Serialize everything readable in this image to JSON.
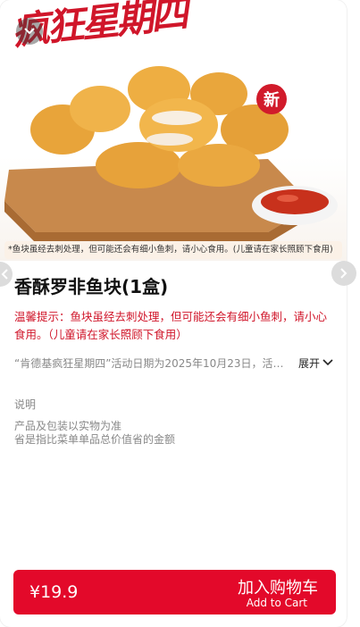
{
  "hero": {
    "promo_title": "疯狂星期四",
    "new_badge": "新",
    "caption": "*鱼块虽经去刺处理，但可能还会有细小鱼刺，请小心食用。(儿童请在家长照顾下食用)"
  },
  "product": {
    "name": "香酥罗非鱼块(1盒)",
    "notice": "温馨提示：鱼块虽经去刺处理，但可能还会有细小鱼刺，请小心食用。（儿童请在家长照顾下食用）",
    "activity": "“肯德基疯狂星期四”活动日期为2025年10月23日，活…",
    "expand_label": "展开"
  },
  "description": {
    "heading": "说明",
    "lines": [
      "产品及包装以实物为准",
      "省是指比菜单单品总价值省的金额"
    ]
  },
  "cart": {
    "price": "¥19.9",
    "add_cn": "加入购物车",
    "add_en": "Add to Cart"
  },
  "colors": {
    "brand_red": "#e3092a",
    "notice_red": "#d0162a"
  },
  "icons": {
    "back": "chevron-down-icon",
    "prev": "chevron-left-icon",
    "next": "chevron-right-icon",
    "expand": "chevron-down-icon"
  }
}
